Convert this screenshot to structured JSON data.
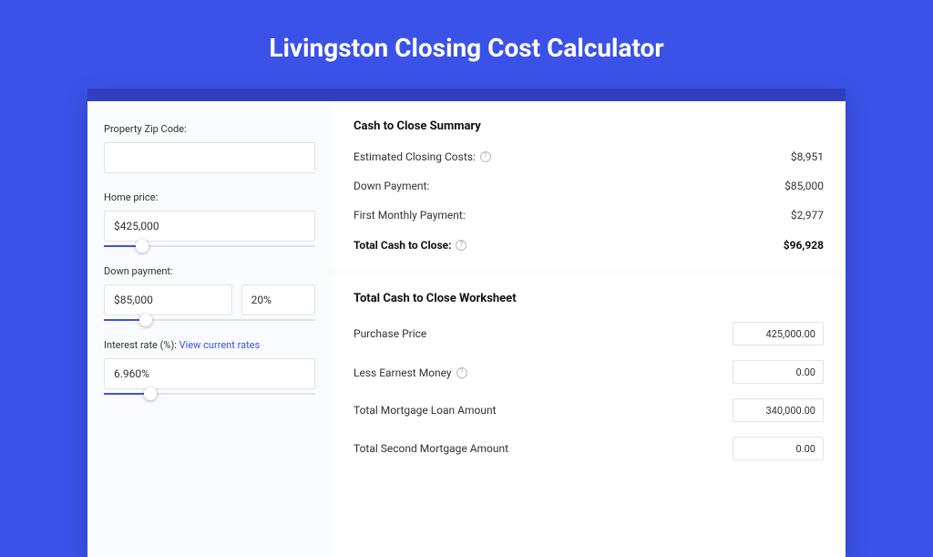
{
  "title": "Livingston Closing Cost Calculator",
  "left": {
    "zip_label": "Property Zip Code:",
    "zip_value": "",
    "home_price_label": "Home price:",
    "home_price_value": "$425,000",
    "home_price_slider_pct": 18,
    "down_label": "Down payment:",
    "down_value": "$85,000",
    "down_pct": "20%",
    "down_slider_pct": 20,
    "rate_label": "Interest rate (%):",
    "rate_link": "View current rates",
    "rate_value": "6.960%",
    "rate_slider_pct": 22
  },
  "summary": {
    "title": "Cash to Close Summary",
    "rows": [
      {
        "label": "Estimated Closing Costs:",
        "value": "$8,951",
        "info": true
      },
      {
        "label": "Down Payment:",
        "value": "$85,000",
        "info": false
      },
      {
        "label": "First Monthly Payment:",
        "value": "$2,977",
        "info": false
      }
    ],
    "total_label": "Total Cash to Close:",
    "total_value": "$96,928"
  },
  "worksheet": {
    "title": "Total Cash to Close Worksheet",
    "rows": [
      {
        "label": "Purchase Price",
        "value": "425,000.00",
        "info": false
      },
      {
        "label": "Less Earnest Money",
        "value": "0.00",
        "info": true
      },
      {
        "label": "Total Mortgage Loan Amount",
        "value": "340,000.00",
        "info": false
      },
      {
        "label": "Total Second Mortgage Amount",
        "value": "0.00",
        "info": false
      }
    ]
  }
}
